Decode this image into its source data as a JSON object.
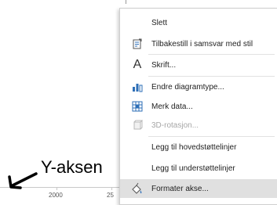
{
  "chart": {
    "tick_labels": [
      "2000",
      "25"
    ]
  },
  "annotation": {
    "label": "Y-aksen"
  },
  "menu": {
    "items": [
      {
        "label": "Slett",
        "icon": "none"
      },
      {
        "label": "Tilbakestill i samsvar med stil",
        "icon": "reset-style-icon"
      },
      {
        "label": "Skrift...",
        "icon": "font-icon"
      },
      {
        "label": "Endre diagramtype...",
        "icon": "chart-type-icon"
      },
      {
        "label": "Merk data...",
        "icon": "select-data-icon"
      },
      {
        "label": "3D-rotasjon...",
        "icon": "3d-rotation-icon",
        "disabled": true
      },
      {
        "label": "Legg til hovedstøttelinjer",
        "icon": "none"
      },
      {
        "label": "Legg til understøttelinjer",
        "icon": "none"
      },
      {
        "label": "Formater akse...",
        "icon": "format-axis-icon",
        "highlighted": true
      }
    ]
  },
  "colors": {
    "highlight": "#e0e0e0",
    "chart_blue": "#2e6fb7",
    "disabled_text": "#a6a6a6"
  }
}
